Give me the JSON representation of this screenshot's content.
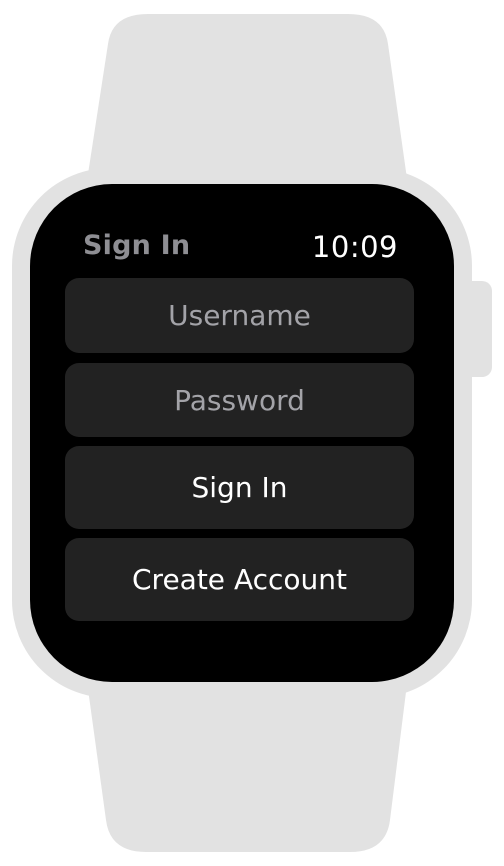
{
  "header": {
    "title": "Sign In",
    "time": "10:09"
  },
  "form": {
    "username_placeholder": "Username",
    "password_placeholder": "Password",
    "signin_label": "Sign In",
    "create_account_label": "Create Account"
  },
  "colors": {
    "band": "#e2e2e2",
    "screen": "#000000",
    "control_bg": "#222222",
    "title": "#8e8e93",
    "placeholder": "#a3a3a8",
    "text": "#ffffff"
  }
}
